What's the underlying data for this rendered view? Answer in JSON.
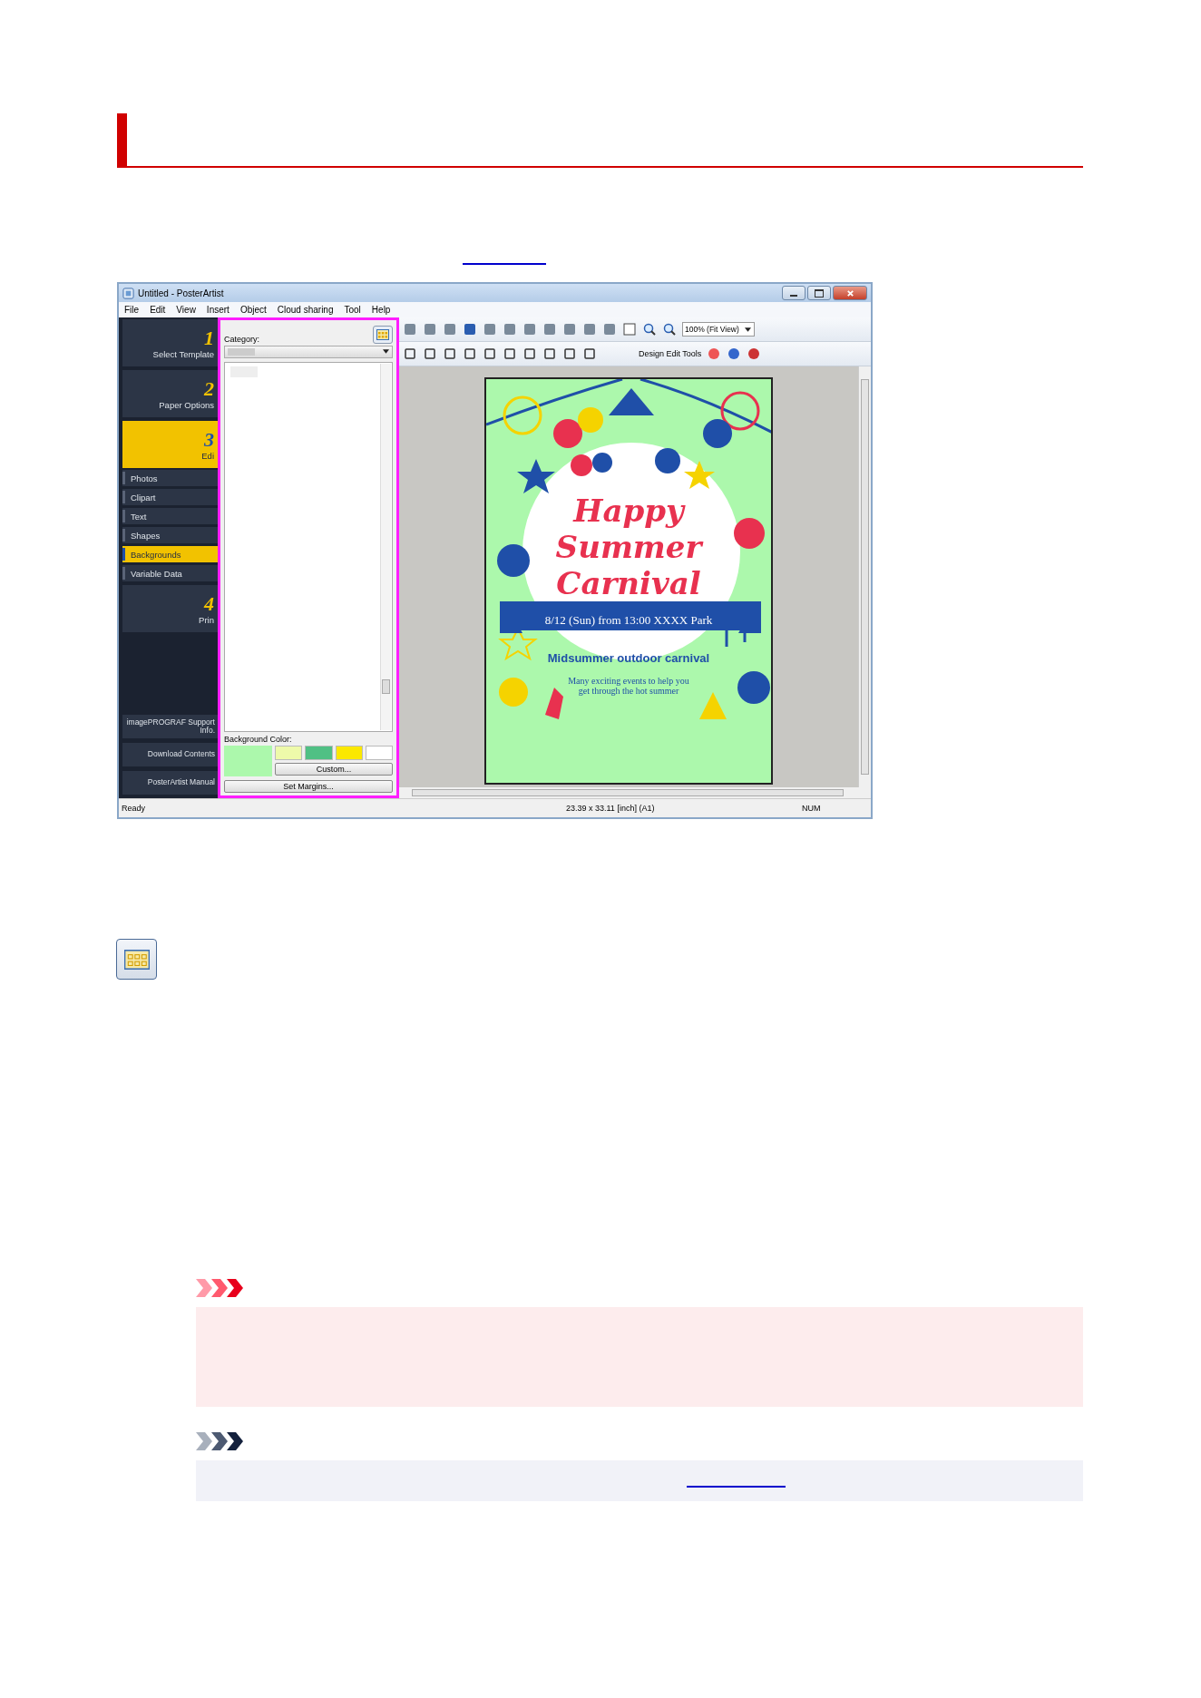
{
  "app_window": {
    "title": "Untitled - PosterArtist",
    "menu": [
      "File",
      "Edit",
      "View",
      "Insert",
      "Object",
      "Cloud sharing",
      "Tool",
      "Help"
    ],
    "steps": [
      {
        "number": "1",
        "label": "Select Template",
        "selected": false
      },
      {
        "number": "2",
        "label": "Paper Options",
        "selected": false
      },
      {
        "number": "3",
        "label": "Edi",
        "selected": true
      },
      {
        "number": "4",
        "label": "Prin",
        "selected": false
      }
    ],
    "sub_items": [
      {
        "label": "Photos",
        "selected": false
      },
      {
        "label": "Clipart",
        "selected": false
      },
      {
        "label": "Text",
        "selected": false
      },
      {
        "label": "Shapes",
        "selected": false
      },
      {
        "label": "Backgrounds",
        "selected": true
      },
      {
        "label": "Variable Data",
        "selected": false
      }
    ],
    "support_buttons": [
      "imagePROGRAF Support Info.",
      "Download Contents",
      "PosterArtist Manual"
    ],
    "category_panel": {
      "category_label": "Category:",
      "background_color_label": "Background Color:",
      "swatches": [
        {
          "kind": "current",
          "color": "#acf8ac"
        },
        {
          "kind": "preset",
          "color": "#eefaaa"
        },
        {
          "kind": "preset",
          "color": "#50c084"
        },
        {
          "kind": "preset",
          "color": "#fbe800"
        },
        {
          "kind": "preset",
          "color": "#ffffff"
        }
      ],
      "custom_button": "Custom...",
      "margins_button": "Set Margins..."
    },
    "toolbar": {
      "zoom": "100% (Fit View)",
      "design_tools_label": "Design Edit Tools"
    },
    "poster": {
      "title_lines": [
        "Happy",
        "Summer",
        "Carnival"
      ],
      "banner": "8/12 (Sun) from 13:00  XXXX Park",
      "subtitle": "Midsummer outdoor carnival",
      "body": "Many exciting events to help you get through the hot summer"
    },
    "status_bar": [
      "Ready",
      "23.39 x 33.11 [inch] (A1)",
      "NUM"
    ]
  }
}
